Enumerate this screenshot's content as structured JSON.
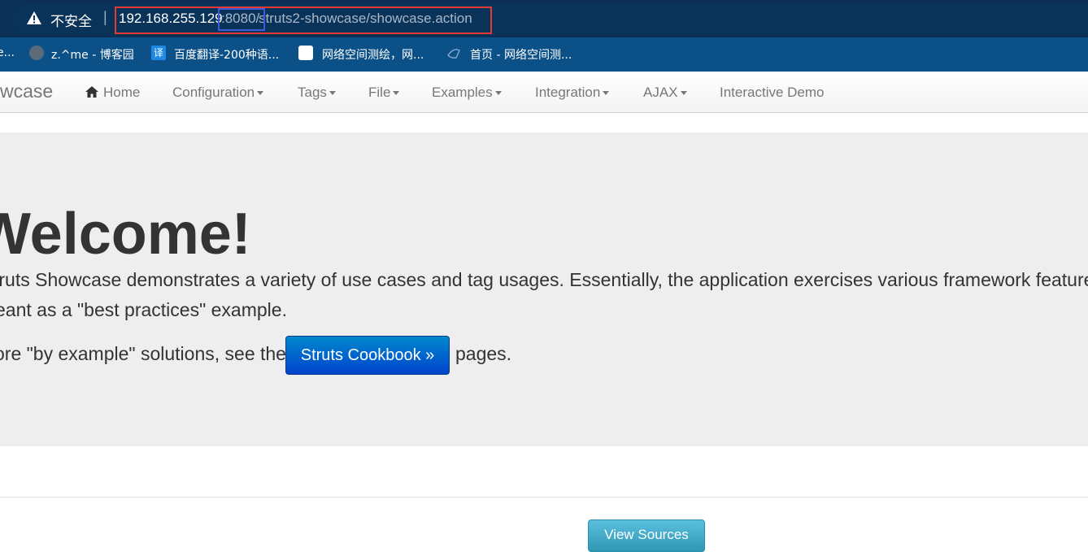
{
  "browser": {
    "insecure_label": "不安全",
    "separator": "|",
    "url_host": "192.168.255.129",
    "url_port": ":8080/",
    "url_path": "struts2-showcase/showcase.action"
  },
  "bookmarks": [
    {
      "label": "e..."
    },
    {
      "label": "z.^me - 博客园"
    },
    {
      "label": "百度翻译-200种语..."
    },
    {
      "label": "网络空间测绘，网..."
    },
    {
      "label": "首页 - 网络空间测..."
    }
  ],
  "bookmark_icons": {
    "translate_glyph": "译"
  },
  "navbar": {
    "brand": "wcase",
    "items": [
      {
        "label": "Home"
      },
      {
        "label": "Configuration"
      },
      {
        "label": "Tags"
      },
      {
        "label": "File"
      },
      {
        "label": "Examples"
      },
      {
        "label": "Integration"
      },
      {
        "label": "AJAX"
      },
      {
        "label": "Interactive Demo"
      }
    ]
  },
  "hero": {
    "heading": "Welcome!",
    "line1": "truts Showcase demonstrates a variety of use cases and tag usages. Essentially, the application exercises various framework features",
    "line2": "eant as a \"best practices\" example.",
    "line3_prefix": "ore \"by example\" solutions, see the",
    "cookbook_button": "Struts Cookbook »",
    "line3_suffix": "pages."
  },
  "footer": {
    "view_sources": "View Sources"
  },
  "colors": {
    "address_bar": "#0c2f55",
    "bookmarks_bar": "#0c5088",
    "hero_bg": "#eeeeee",
    "primary_button": "#0044cc",
    "info_button": "#5bc0de",
    "highlight_red": "#e53935",
    "highlight_blue": "#3b5bdb"
  }
}
